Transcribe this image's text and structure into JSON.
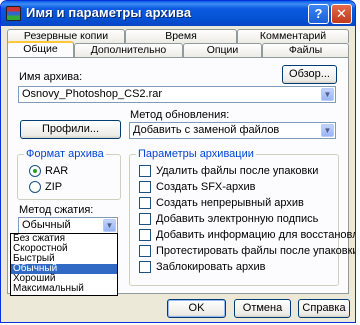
{
  "window": {
    "title": "Имя и параметры архива",
    "help_glyph": "?",
    "close_glyph": "✕"
  },
  "tabs": {
    "back_row": [
      "Резервные копии",
      "Время",
      "Комментарий"
    ],
    "front_row": [
      "Общие",
      "Дополнительно",
      "Опции",
      "Файлы"
    ],
    "active": "Общие"
  },
  "archive_name": {
    "label": "Имя архива:",
    "value": "Osnovy_Photoshop_CS2.rar",
    "browse_label": "Обзор..."
  },
  "update_method": {
    "label": "Метод обновления:",
    "value": "Добавить с заменой файлов"
  },
  "profiles_label": "Профили...",
  "archive_format": {
    "title": "Формат архива",
    "options": [
      "RAR",
      "ZIP"
    ],
    "selected": "RAR"
  },
  "compression": {
    "label": "Метод сжатия:",
    "value": "Обычный",
    "options": [
      "Без сжатия",
      "Скоростной",
      "Быстрый",
      "Обычный",
      "Хороший",
      "Максимальный"
    ],
    "highlighted": "Обычный"
  },
  "archive_params": {
    "title": "Параметры архивации",
    "items": [
      "Удалить файлы после упаковки",
      "Создать SFX-архив",
      "Создать непрерывный архив",
      "Добавить электронную подпись",
      "Добавить информацию для восстановления",
      "Протестировать файлы после упаковки",
      "Заблокировать архив"
    ]
  },
  "footer": {
    "ok": "OK",
    "cancel": "Отмена",
    "help": "Справка"
  },
  "colors": {
    "titlebar": "#0552d5",
    "group_title": "#0046d5",
    "selection": "#316ac5",
    "dialog_bg": "#ece9d8"
  }
}
